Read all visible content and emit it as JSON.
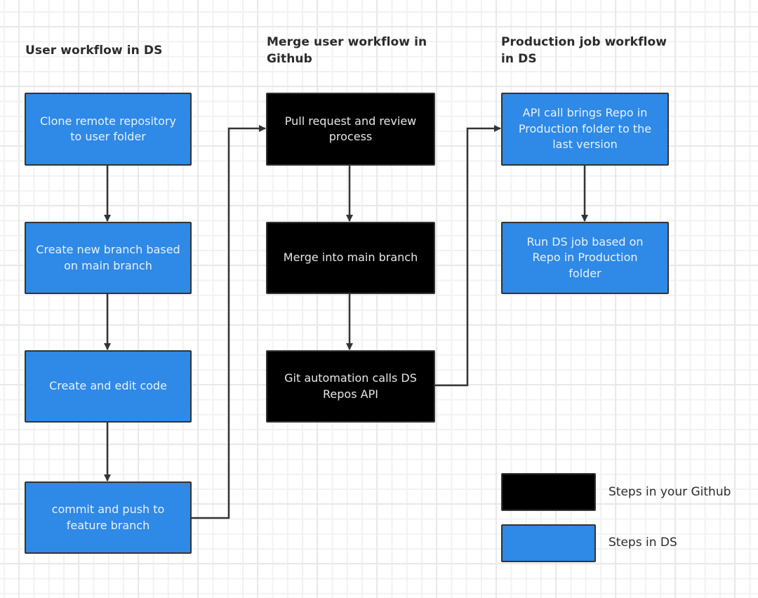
{
  "columns": [
    {
      "title": "User workflow in DS",
      "steps": [
        {
          "text": "Clone remote repository to user folder",
          "kind": "ds"
        },
        {
          "text": "Create new branch based on main branch",
          "kind": "ds"
        },
        {
          "text": "Create and edit code",
          "kind": "ds"
        },
        {
          "text": "commit and push to feature branch",
          "kind": "ds"
        }
      ]
    },
    {
      "title": "Merge user workflow in Github",
      "steps": [
        {
          "text": "Pull request and review process",
          "kind": "github"
        },
        {
          "text": "Merge into main branch",
          "kind": "github"
        },
        {
          "text": "Git automation calls DS Repos API",
          "kind": "github"
        }
      ]
    },
    {
      "title": "Production job workflow in DS",
      "steps": [
        {
          "text": "API call brings Repo in Production folder to the last version",
          "kind": "ds"
        },
        {
          "text": "Run DS job based on Repo in Production folder",
          "kind": "ds"
        }
      ]
    }
  ],
  "legend": [
    {
      "label": "Steps in your Github",
      "kind": "github",
      "color": "#000000"
    },
    {
      "label": "Steps in DS",
      "kind": "ds",
      "color": "#2f89e6"
    }
  ],
  "colors": {
    "ds_step": "#2f89e6",
    "github_step": "#000000",
    "border": "#333333",
    "connector": "#333333"
  },
  "edges": [
    {
      "from": "Clone remote repository to user folder",
      "to": "Create new branch based on main branch"
    },
    {
      "from": "Create new branch based on main branch",
      "to": "Create and edit code"
    },
    {
      "from": "Create and edit code",
      "to": "commit and push to feature branch"
    },
    {
      "from": "commit and push to feature branch",
      "to": "Pull request and review process"
    },
    {
      "from": "Pull request and review process",
      "to": "Merge into main branch"
    },
    {
      "from": "Merge into main branch",
      "to": "Git automation calls DS Repos API"
    },
    {
      "from": "Git automation calls DS Repos API",
      "to": "API call brings Repo in Production folder to the last version"
    },
    {
      "from": "API call brings Repo in Production folder to the last version",
      "to": "Run DS job based on Repo in Production folder"
    }
  ]
}
